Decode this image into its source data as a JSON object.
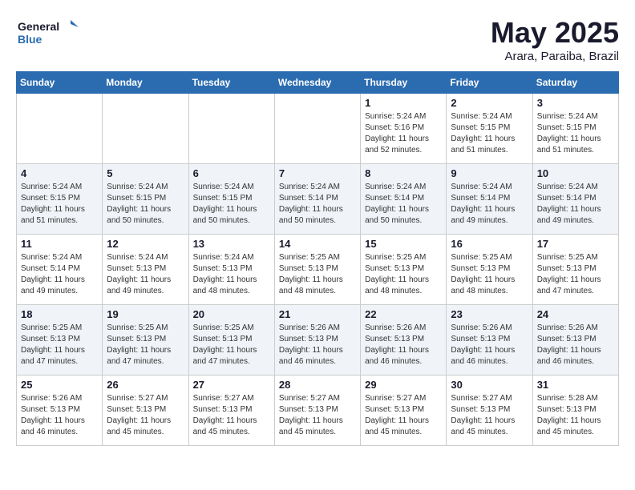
{
  "logo": {
    "line1": "General",
    "line2": "Blue"
  },
  "title": "May 2025",
  "subtitle": "Arara, Paraiba, Brazil",
  "days_header": [
    "Sunday",
    "Monday",
    "Tuesday",
    "Wednesday",
    "Thursday",
    "Friday",
    "Saturday"
  ],
  "weeks": [
    [
      {
        "num": "",
        "info": ""
      },
      {
        "num": "",
        "info": ""
      },
      {
        "num": "",
        "info": ""
      },
      {
        "num": "",
        "info": ""
      },
      {
        "num": "1",
        "info": "Sunrise: 5:24 AM\nSunset: 5:16 PM\nDaylight: 11 hours\nand 52 minutes."
      },
      {
        "num": "2",
        "info": "Sunrise: 5:24 AM\nSunset: 5:15 PM\nDaylight: 11 hours\nand 51 minutes."
      },
      {
        "num": "3",
        "info": "Sunrise: 5:24 AM\nSunset: 5:15 PM\nDaylight: 11 hours\nand 51 minutes."
      }
    ],
    [
      {
        "num": "4",
        "info": "Sunrise: 5:24 AM\nSunset: 5:15 PM\nDaylight: 11 hours\nand 51 minutes."
      },
      {
        "num": "5",
        "info": "Sunrise: 5:24 AM\nSunset: 5:15 PM\nDaylight: 11 hours\nand 50 minutes."
      },
      {
        "num": "6",
        "info": "Sunrise: 5:24 AM\nSunset: 5:15 PM\nDaylight: 11 hours\nand 50 minutes."
      },
      {
        "num": "7",
        "info": "Sunrise: 5:24 AM\nSunset: 5:14 PM\nDaylight: 11 hours\nand 50 minutes."
      },
      {
        "num": "8",
        "info": "Sunrise: 5:24 AM\nSunset: 5:14 PM\nDaylight: 11 hours\nand 50 minutes."
      },
      {
        "num": "9",
        "info": "Sunrise: 5:24 AM\nSunset: 5:14 PM\nDaylight: 11 hours\nand 49 minutes."
      },
      {
        "num": "10",
        "info": "Sunrise: 5:24 AM\nSunset: 5:14 PM\nDaylight: 11 hours\nand 49 minutes."
      }
    ],
    [
      {
        "num": "11",
        "info": "Sunrise: 5:24 AM\nSunset: 5:14 PM\nDaylight: 11 hours\nand 49 minutes."
      },
      {
        "num": "12",
        "info": "Sunrise: 5:24 AM\nSunset: 5:13 PM\nDaylight: 11 hours\nand 49 minutes."
      },
      {
        "num": "13",
        "info": "Sunrise: 5:24 AM\nSunset: 5:13 PM\nDaylight: 11 hours\nand 48 minutes."
      },
      {
        "num": "14",
        "info": "Sunrise: 5:25 AM\nSunset: 5:13 PM\nDaylight: 11 hours\nand 48 minutes."
      },
      {
        "num": "15",
        "info": "Sunrise: 5:25 AM\nSunset: 5:13 PM\nDaylight: 11 hours\nand 48 minutes."
      },
      {
        "num": "16",
        "info": "Sunrise: 5:25 AM\nSunset: 5:13 PM\nDaylight: 11 hours\nand 48 minutes."
      },
      {
        "num": "17",
        "info": "Sunrise: 5:25 AM\nSunset: 5:13 PM\nDaylight: 11 hours\nand 47 minutes."
      }
    ],
    [
      {
        "num": "18",
        "info": "Sunrise: 5:25 AM\nSunset: 5:13 PM\nDaylight: 11 hours\nand 47 minutes."
      },
      {
        "num": "19",
        "info": "Sunrise: 5:25 AM\nSunset: 5:13 PM\nDaylight: 11 hours\nand 47 minutes."
      },
      {
        "num": "20",
        "info": "Sunrise: 5:25 AM\nSunset: 5:13 PM\nDaylight: 11 hours\nand 47 minutes."
      },
      {
        "num": "21",
        "info": "Sunrise: 5:26 AM\nSunset: 5:13 PM\nDaylight: 11 hours\nand 46 minutes."
      },
      {
        "num": "22",
        "info": "Sunrise: 5:26 AM\nSunset: 5:13 PM\nDaylight: 11 hours\nand 46 minutes."
      },
      {
        "num": "23",
        "info": "Sunrise: 5:26 AM\nSunset: 5:13 PM\nDaylight: 11 hours\nand 46 minutes."
      },
      {
        "num": "24",
        "info": "Sunrise: 5:26 AM\nSunset: 5:13 PM\nDaylight: 11 hours\nand 46 minutes."
      }
    ],
    [
      {
        "num": "25",
        "info": "Sunrise: 5:26 AM\nSunset: 5:13 PM\nDaylight: 11 hours\nand 46 minutes."
      },
      {
        "num": "26",
        "info": "Sunrise: 5:27 AM\nSunset: 5:13 PM\nDaylight: 11 hours\nand 45 minutes."
      },
      {
        "num": "27",
        "info": "Sunrise: 5:27 AM\nSunset: 5:13 PM\nDaylight: 11 hours\nand 45 minutes."
      },
      {
        "num": "28",
        "info": "Sunrise: 5:27 AM\nSunset: 5:13 PM\nDaylight: 11 hours\nand 45 minutes."
      },
      {
        "num": "29",
        "info": "Sunrise: 5:27 AM\nSunset: 5:13 PM\nDaylight: 11 hours\nand 45 minutes."
      },
      {
        "num": "30",
        "info": "Sunrise: 5:27 AM\nSunset: 5:13 PM\nDaylight: 11 hours\nand 45 minutes."
      },
      {
        "num": "31",
        "info": "Sunrise: 5:28 AM\nSunset: 5:13 PM\nDaylight: 11 hours\nand 45 minutes."
      }
    ]
  ]
}
